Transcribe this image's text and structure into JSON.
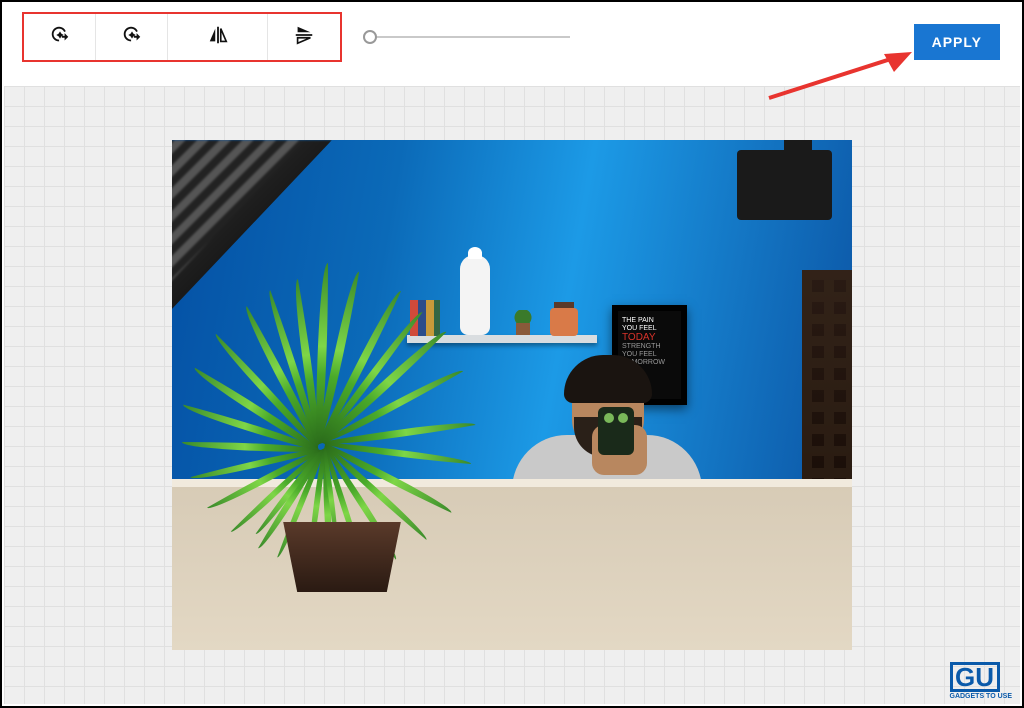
{
  "toolbar": {
    "rotate_ccw": "rotate-left-icon",
    "rotate_cw": "rotate-right-icon",
    "flip_h": "flip-horizontal-icon",
    "flip_v": "flip-vertical-icon",
    "slider_value": 0
  },
  "actions": {
    "apply_label": "APPLY"
  },
  "poster": {
    "line1": "THE PAIN",
    "line2": "YOU FEEL",
    "line3": "TODAY",
    "line4": "STRENGTH",
    "line5": "YOU FEEL",
    "line6": "TOMORROW"
  },
  "watermark": {
    "logo_text": "GU",
    "caption": "GADGETS TO USE"
  },
  "colors": {
    "accent": "#1976d2",
    "highlight": "#e8342f"
  }
}
